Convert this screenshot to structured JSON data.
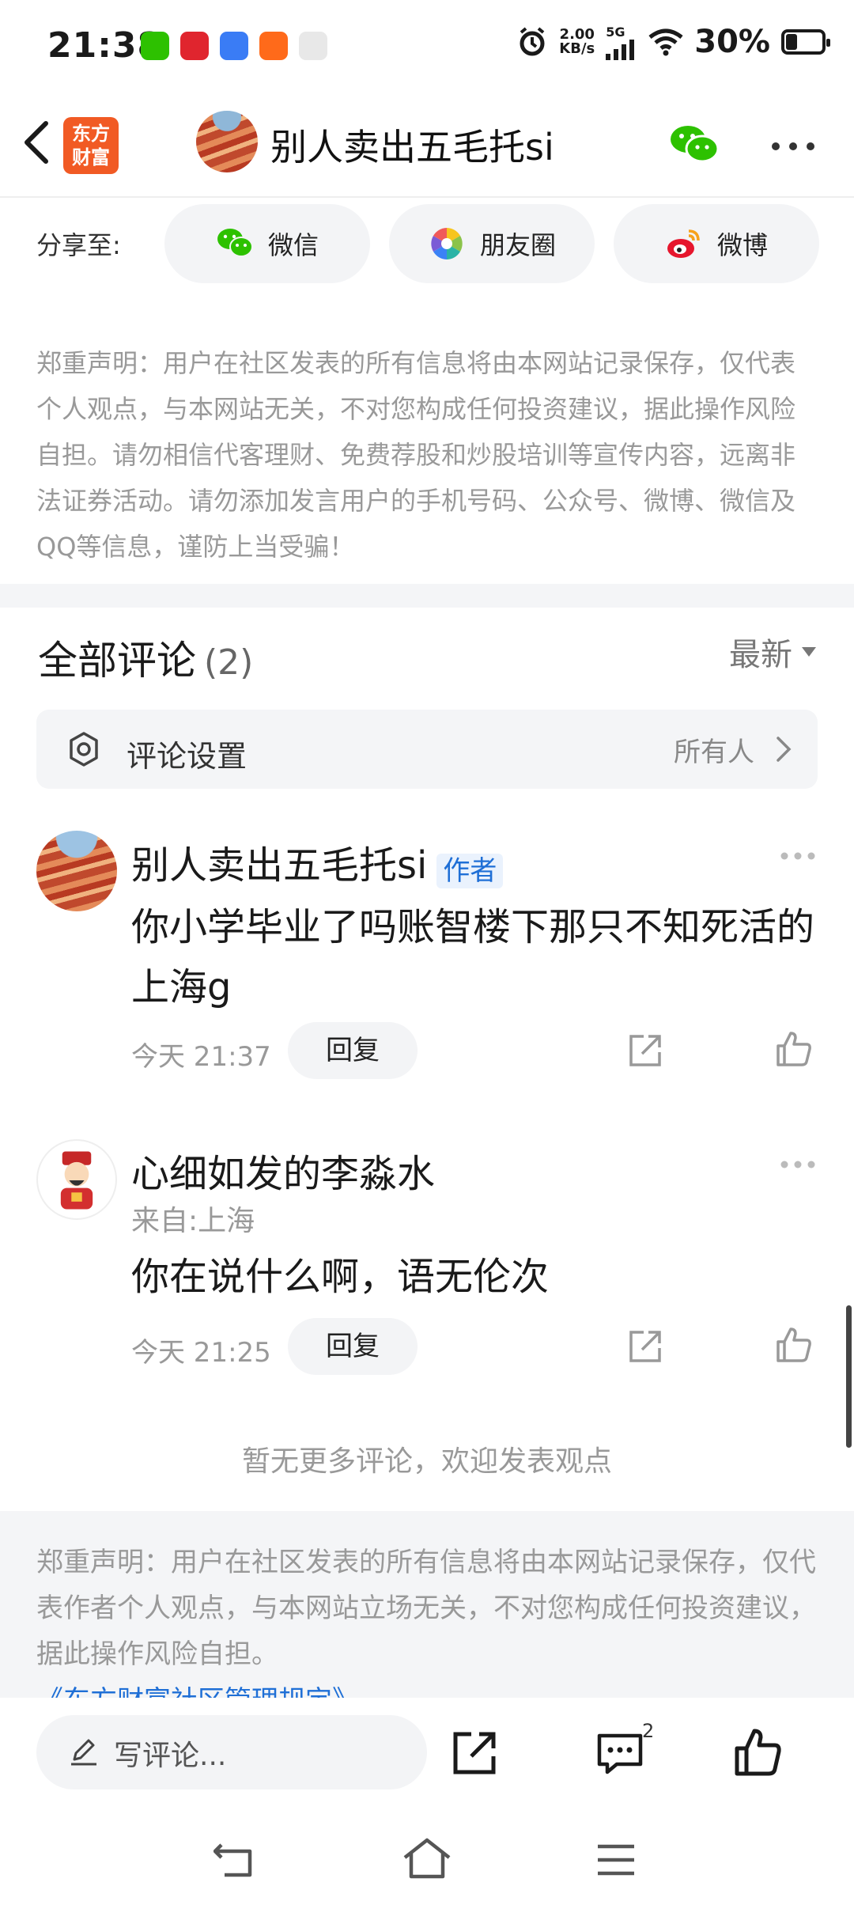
{
  "status_bar": {
    "time": "21:38",
    "net_speed_value": "2.00",
    "net_speed_unit": "KB/s",
    "network": "5G",
    "battery": "30%",
    "app_icons": [
      "wechat-icon",
      "taobao-icon",
      "app-blue-icon",
      "app-orange-icon",
      "maps-icon"
    ]
  },
  "header": {
    "logo_text_line1": "东方",
    "logo_text_line2": "财富",
    "title": "别人卖出五毛托si"
  },
  "share": {
    "label": "分享至:",
    "wechat": "微信",
    "moments": "朋友圈",
    "weibo": "微博"
  },
  "disclaimer_top": "郑重声明：用户在社区发表的所有信息将由本网站记录保存，仅代表个人观点，与本网站无关，不对您构成任何投资建议，据此操作风险自担。请勿相信代客理财、免费荐股和炒股培训等宣传内容，远离非法证券活动。请勿添加发言用户的手机号码、公众号、微博、微信及QQ等信息，谨防上当受骗！",
  "comments_section": {
    "title": "全部评论",
    "count": "(2)",
    "sort": "最新",
    "settings_label": "评论设置",
    "settings_value": "所有人",
    "items": [
      {
        "name": "别人卖出五毛托si",
        "badge": "作者",
        "location": "",
        "body": "你小学毕业了吗账智楼下那只不知死活的上海g",
        "time": "今天 21:37",
        "reply": "回复"
      },
      {
        "name": "心细如发的李淼水",
        "badge": "",
        "location": "来自:上海",
        "body": "你在说什么啊，语无伦次",
        "time": "今天 21:25",
        "reply": "回复"
      }
    ],
    "no_more": "暂无更多评论，欢迎发表观点"
  },
  "disclaimer_bottom": "郑重声明：用户在社区发表的所有信息将由本网站记录保存，仅代表作者个人观点，与本网站立场无关，不对您构成任何投资建议，据此操作风险自担。",
  "rules_link": "《东方财富社区管理规定》",
  "toolbar": {
    "write_placeholder": "写评论...",
    "comment_count": "2"
  },
  "colors": {
    "accent_blue": "#1f6fd6",
    "brand_orange": "#f15a24",
    "wechat_green": "#2dc100"
  }
}
